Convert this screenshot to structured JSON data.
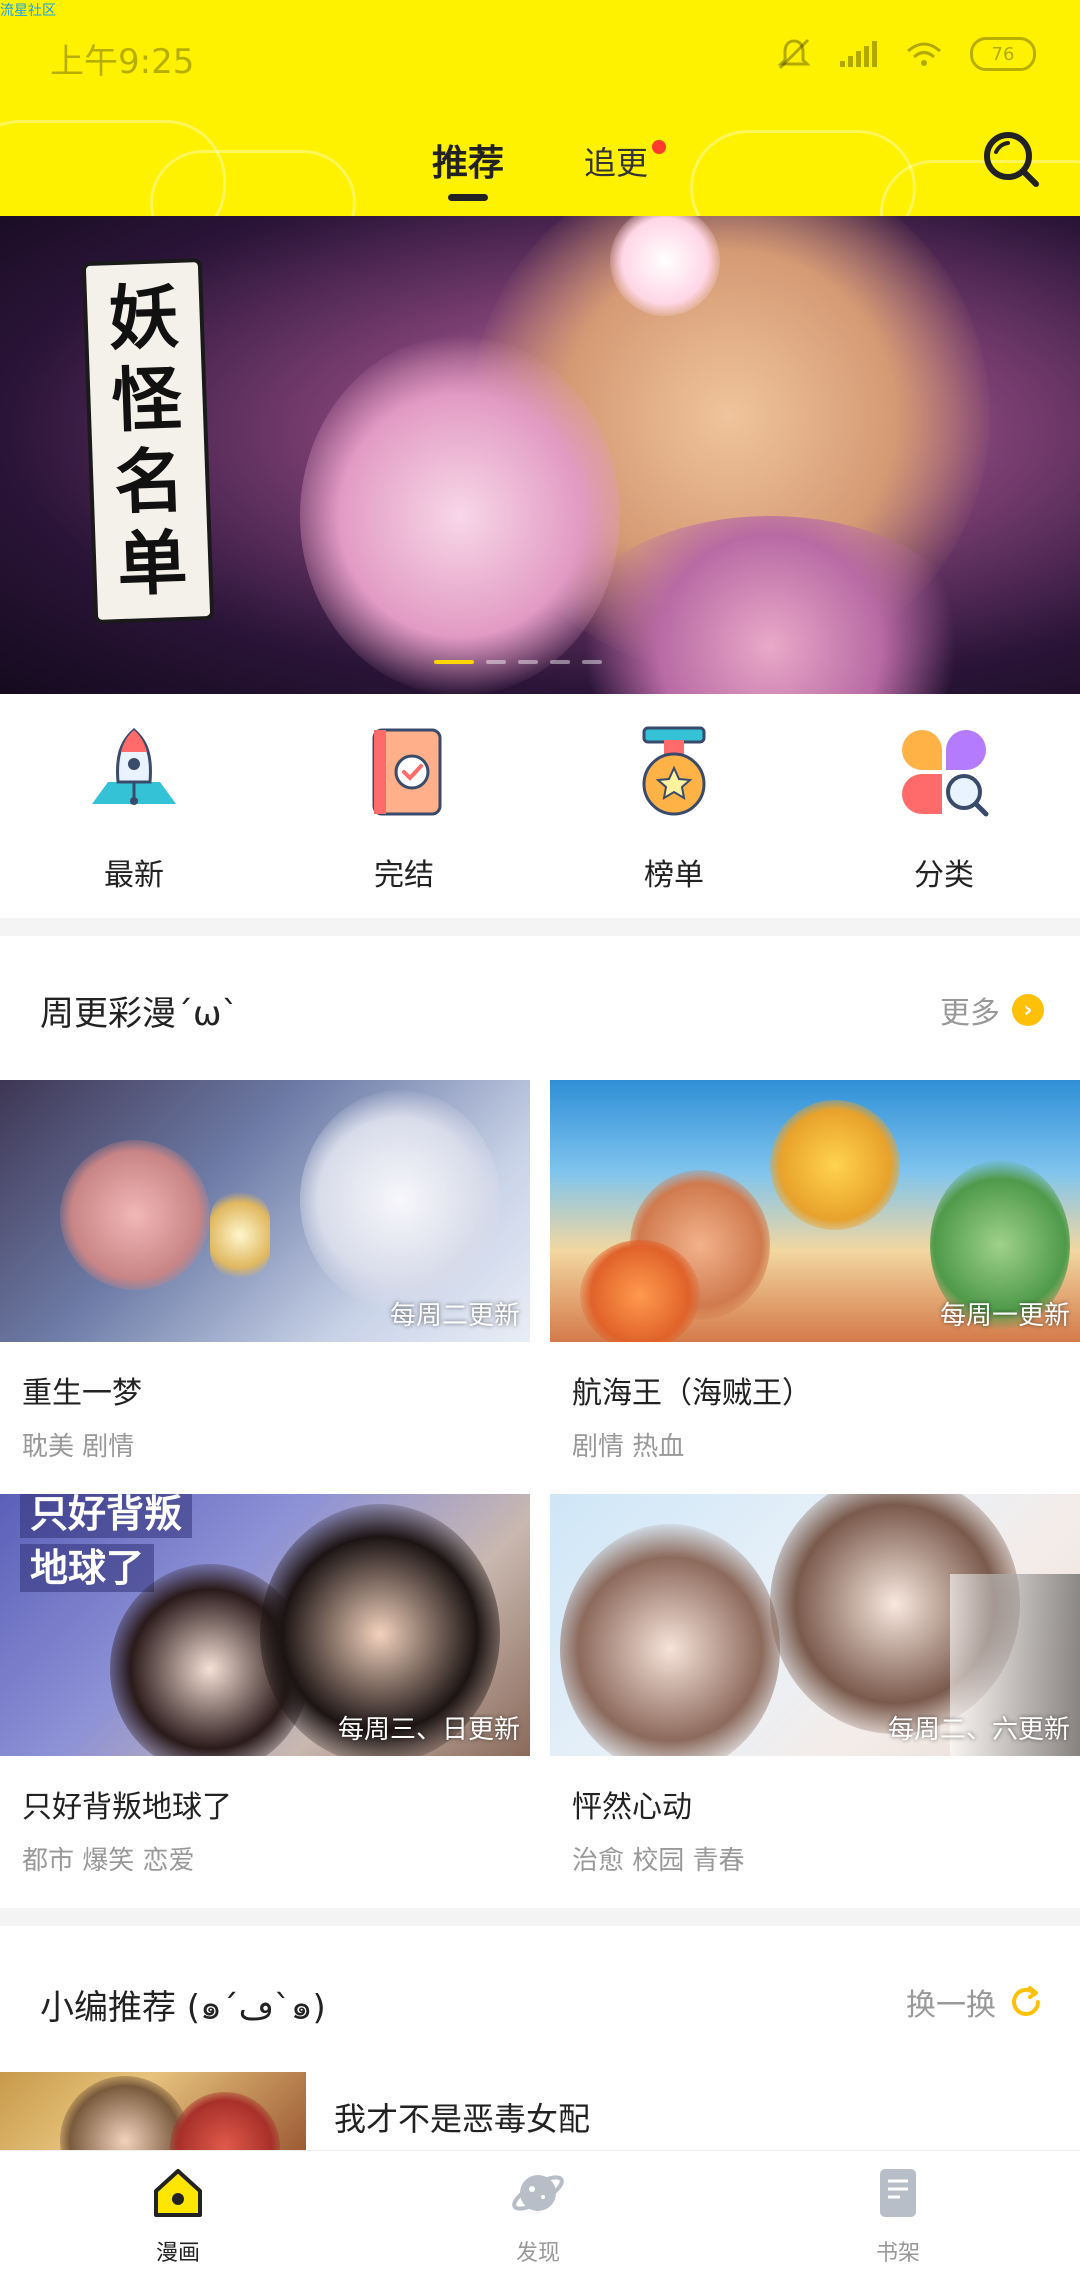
{
  "watermark": "流星社区",
  "status_bar": {
    "time": "上午9:25",
    "battery": "76"
  },
  "header": {
    "tabs": [
      {
        "label": "推荐",
        "active": true
      },
      {
        "label": "追更",
        "badge": true
      }
    ]
  },
  "banner": {
    "title_chars": [
      "妖",
      "怪",
      "名",
      "单"
    ],
    "page_count": 5,
    "active_page": 1
  },
  "categories": [
    {
      "label": "最新",
      "icon": "rocket-icon"
    },
    {
      "label": "完结",
      "icon": "book-check-icon"
    },
    {
      "label": "榜单",
      "icon": "medal-icon"
    },
    {
      "label": "分类",
      "icon": "category-grid-icon"
    }
  ],
  "weekly_section": {
    "title": "周更彩漫´ω`",
    "more_label": "更多",
    "items": [
      {
        "title": "重生一梦",
        "tags": "耽美 剧情",
        "update": "每周二更新"
      },
      {
        "title": "航海王（海贼王）",
        "tags": "剧情 热血",
        "update": "每周一更新"
      },
      {
        "title": "只好背叛地球了",
        "tags": "都市 爆笑 恋爱",
        "update": "每周三、日更新",
        "cover_text": [
          "只好背叛",
          "地球了"
        ]
      },
      {
        "title": "怦然心动",
        "tags": "治愈 校园 青春",
        "update": "每周二、六更新"
      }
    ]
  },
  "editor_section": {
    "title": "小编推荐 (๑´ڡ`๑)",
    "refresh_label": "换一换",
    "first_item_title": "我才不是恶毒女配"
  },
  "bottom_nav": [
    {
      "label": "漫画",
      "active": true
    },
    {
      "label": "发现",
      "active": false
    },
    {
      "label": "书架",
      "active": false
    }
  ],
  "colors": {
    "brand_yellow": "#fff200",
    "accent_orange": "#ffc107",
    "badge_red": "#ff3b30"
  }
}
